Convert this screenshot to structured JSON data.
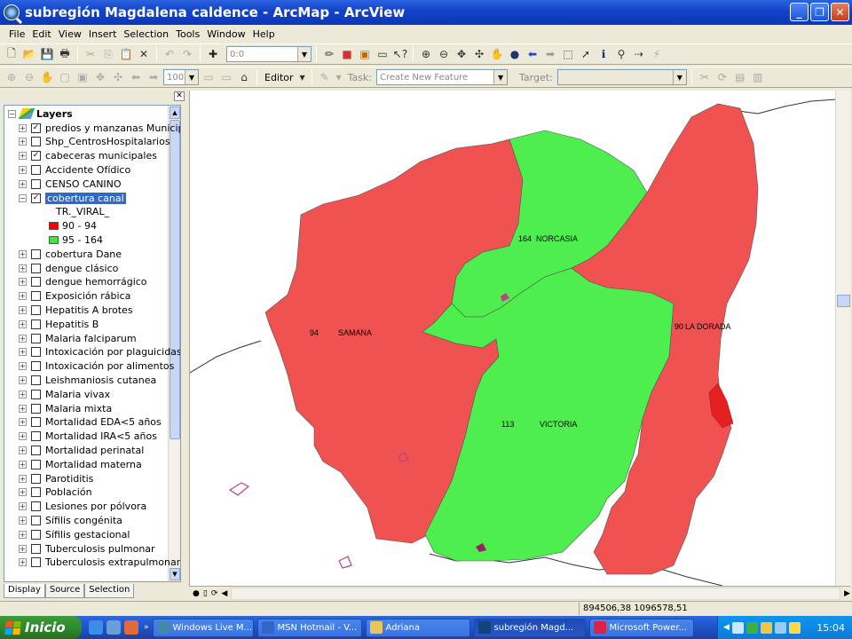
{
  "window": {
    "title": "subregión Magdalena caldence - ArcMap - ArcView",
    "btn_min": "_",
    "btn_max": "❐",
    "btn_close": "✕"
  },
  "menu": [
    "File",
    "Edit",
    "View",
    "Insert",
    "Selection",
    "Tools",
    "Window",
    "Help"
  ],
  "toolbar": {
    "scale_value": "0:0",
    "zoom_percent": "100",
    "editor_label": "Editor",
    "task_label": "Task:",
    "task_value": "Create New Feature",
    "target_label": "Target:",
    "target_value": ""
  },
  "toc": {
    "root_label": "Layers",
    "layers": [
      {
        "label": "predios y manzanas Municipios",
        "checked": true,
        "expanded": false
      },
      {
        "label": "Shp_CentrosHospitalarios",
        "checked": false,
        "expanded": false
      },
      {
        "label": "cabeceras municipales",
        "checked": true,
        "expanded": false
      },
      {
        "label": "Accidente Ofídico",
        "checked": false,
        "expanded": false
      },
      {
        "label": "CENSO CANINO",
        "checked": false,
        "expanded": false
      },
      {
        "label": "cobertura canal",
        "checked": true,
        "expanded": true,
        "selected": true
      },
      {
        "label": "cobertura Dane",
        "checked": false,
        "expanded": false
      },
      {
        "label": "dengue clásico",
        "checked": false,
        "expanded": false
      },
      {
        "label": "dengue hemorrágico",
        "checked": false,
        "expanded": false
      },
      {
        "label": "Exposición rábica",
        "checked": false,
        "expanded": false
      },
      {
        "label": "Hepatitis A brotes",
        "checked": false,
        "expanded": false
      },
      {
        "label": "Hepatitis B",
        "checked": false,
        "expanded": false
      },
      {
        "label": "Malaria falciparum",
        "checked": false,
        "expanded": false
      },
      {
        "label": "Intoxicación por plaguicidas",
        "checked": false,
        "expanded": false
      },
      {
        "label": "Intoxicación por alimentos",
        "checked": false,
        "expanded": false
      },
      {
        "label": "Leishmaniosis cutanea",
        "checked": false,
        "expanded": false
      },
      {
        "label": "Malaria vivax",
        "checked": false,
        "expanded": false
      },
      {
        "label": "Malaria mixta",
        "checked": false,
        "expanded": false
      },
      {
        "label": "Mortalidad EDA<5 años",
        "checked": false,
        "expanded": false
      },
      {
        "label": "Mortalidad IRA<5 años",
        "checked": false,
        "expanded": false
      },
      {
        "label": "Mortalidad perinatal",
        "checked": false,
        "expanded": false
      },
      {
        "label": "Mortalidad materna",
        "checked": false,
        "expanded": false
      },
      {
        "label": "Parotiditis",
        "checked": false,
        "expanded": false
      },
      {
        "label": "Población",
        "checked": false,
        "expanded": false
      },
      {
        "label": "Lesiones por pólvora",
        "checked": false,
        "expanded": false
      },
      {
        "label": "Sífilis congénita",
        "checked": false,
        "expanded": false
      },
      {
        "label": "Sífilis gestacional",
        "checked": false,
        "expanded": false
      },
      {
        "label": "Tuberculosis pulmonar",
        "checked": false,
        "expanded": false
      },
      {
        "label": "Tuberculosis extrapulmonar",
        "checked": false,
        "expanded": false
      }
    ],
    "legend_field": "TR._VIRAL_",
    "legend": [
      {
        "label": "90 - 94",
        "color": "#ff0000"
      },
      {
        "label": "95 - 164",
        "color": "#33ee33"
      }
    ],
    "tabs": [
      "Display",
      "Source",
      "Selection"
    ]
  },
  "map": {
    "red_color": "#f05252",
    "green_color": "#4dee4d",
    "labels": [
      {
        "value": "164",
        "name": "NORCASIA"
      },
      {
        "value": "94",
        "name": "SAMANA"
      },
      {
        "value": "90",
        "name": "LA DORADA"
      },
      {
        "value": "113",
        "name": "VICTORIA"
      }
    ]
  },
  "status": {
    "coordinates": "894506,38  1096578,51 Unknown"
  },
  "taskbar": {
    "start_label": "Inicio",
    "tasks": [
      {
        "label": "Windows Live M...",
        "active": false
      },
      {
        "label": "MSN Hotmail - V...",
        "active": false
      },
      {
        "label": "Adriana",
        "active": false
      },
      {
        "label": "subregión Magd...",
        "active": true
      },
      {
        "label": "Microsoft Power...",
        "active": false
      }
    ],
    "clock": "15:04"
  }
}
